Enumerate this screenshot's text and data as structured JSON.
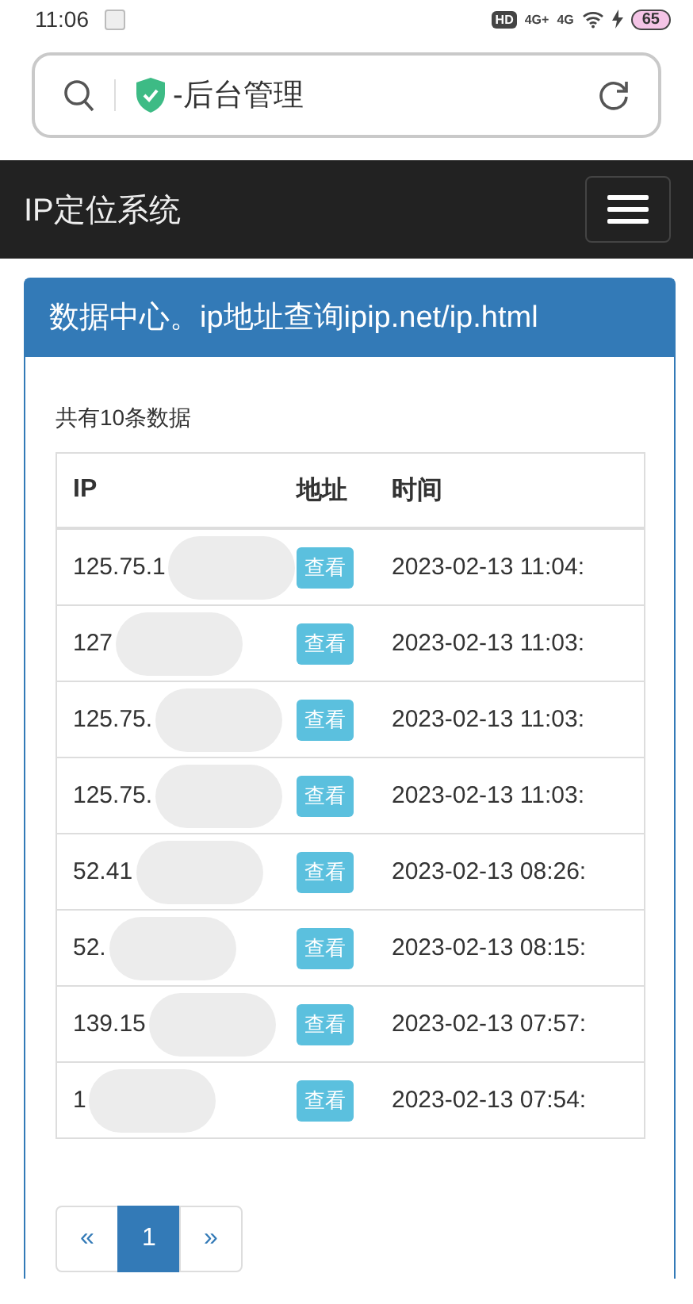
{
  "status_bar": {
    "time": "11:06",
    "network_1": "4G+",
    "network_2": "4G",
    "hd": "HD",
    "battery": "65"
  },
  "address_bar": {
    "title": "-后台管理"
  },
  "navbar": {
    "brand": "IP定位系统"
  },
  "panel": {
    "heading": "数据中心。ip地址查询ipip.net/ip.html",
    "count": "共有10条数据"
  },
  "table": {
    "columns": [
      "IP",
      "地址",
      "时间"
    ],
    "rows": [
      {
        "ip": "125.75.1",
        "action": "查看",
        "time": "2023-02-13 11:04:"
      },
      {
        "ip": "127",
        "action": "查看",
        "time": "2023-02-13 11:03:"
      },
      {
        "ip": "125.75.",
        "action": "查看",
        "time": "2023-02-13 11:03:"
      },
      {
        "ip": "125.75.",
        "action": "查看",
        "time": "2023-02-13 11:03:"
      },
      {
        "ip": "52.41",
        "action": "查看",
        "time": "2023-02-13 08:26:"
      },
      {
        "ip": "52.",
        "action": "查看",
        "time": "2023-02-13 08:15:"
      },
      {
        "ip": "139.15",
        "action": "查看",
        "time": "2023-02-13 07:57:"
      },
      {
        "ip": "1",
        "action": "查看",
        "time": "2023-02-13 07:54:"
      }
    ]
  },
  "pagination": [
    {
      "label": "«",
      "selected": false
    },
    {
      "label": "1",
      "selected": true
    },
    {
      "label": "»",
      "selected": false
    }
  ]
}
